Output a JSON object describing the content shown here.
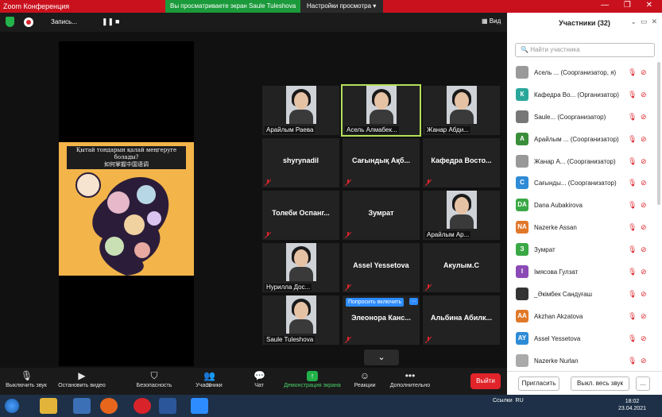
{
  "window": {
    "title": "Zoom Конференция",
    "share_banner": "Вы просматриваете экран Saule Tuleshova",
    "view_settings": "Настройки просмотра",
    "controls": "—  ❐  ✕"
  },
  "recording": {
    "label": "Запись...",
    "pause": "❚❚",
    "stop": "■"
  },
  "view": {
    "label": "Вид"
  },
  "poster": {
    "caption": "Қытай тондарын қалай меңгеруге болады?\n如何掌握中国语调"
  },
  "tiles": [
    {
      "name": "Арайлым Раева",
      "type": "video"
    },
    {
      "name": "Асель Алмабек...",
      "type": "video",
      "active": true
    },
    {
      "name": "Жанар Абди...",
      "type": "video"
    },
    {
      "name": "shyrynadil",
      "type": "name"
    },
    {
      "name": "Сағындық Ақб...",
      "type": "name"
    },
    {
      "name": "Кафедра Восто...",
      "type": "name"
    },
    {
      "name": "Толеби Оспанг...",
      "type": "name"
    },
    {
      "name": "Зумрат",
      "type": "name"
    },
    {
      "name": "Арайлым Ар...",
      "type": "video"
    },
    {
      "name": "Нурилла Дос...",
      "type": "video"
    },
    {
      "name": "Assel Yessetova",
      "type": "name"
    },
    {
      "name": "Акулым.С",
      "type": "name"
    },
    {
      "name": "Saule Tuleshova",
      "type": "video"
    },
    {
      "name": "Элеонора Канс...",
      "type": "name"
    },
    {
      "name": "Альбина Абилк...",
      "type": "name"
    }
  ],
  "ask_unmute": "Попросить включить",
  "toolbar": {
    "mute": "Выключить звук",
    "video": "Остановить видео",
    "security": "Безопасность",
    "participants": "Участники",
    "participants_count": "32",
    "chat": "Чат",
    "share": "Демонстрация экрана",
    "reactions": "Реакции",
    "more": "Дополнительно",
    "leave": "Выйти"
  },
  "panel": {
    "title": "Участники (32)",
    "search_placeholder": "Найти участника",
    "invite": "Пригласить",
    "mute_all": "Выкл. весь звук",
    "more": "...",
    "participants": [
      {
        "initials": "",
        "name": "Асель ... (Соорганизатор, я)",
        "color": "#9a9a9a"
      },
      {
        "initials": "К",
        "name": "Кафедра Во... (Организатор)",
        "color": "#2aa79b"
      },
      {
        "initials": "",
        "name": "Saule... (Соорганизатор)",
        "color": "#777"
      },
      {
        "initials": "А",
        "name": "Арайлым ... (Соорганизатор)",
        "color": "#3a8e3a"
      },
      {
        "initials": "",
        "name": "Жанар А... (Соорганизатор)",
        "color": "#999"
      },
      {
        "initials": "С",
        "name": "Сағынды... (Соорганизатор)",
        "color": "#2e8bd6"
      },
      {
        "initials": "DA",
        "name": "Dana Aubakirova",
        "color": "#3aa844"
      },
      {
        "initials": "NA",
        "name": "Nazerke Assan",
        "color": "#e0782a"
      },
      {
        "initials": "З",
        "name": "Зумрат",
        "color": "#3aa844"
      },
      {
        "initials": "I",
        "name": "Імясова Гулзат",
        "color": "#8b4ab5"
      },
      {
        "initials": "",
        "name": "_Әкімбек Сандуғаш",
        "color": "#333"
      },
      {
        "initials": "AA",
        "name": "Akzhan Akzatova",
        "color": "#e0782a"
      },
      {
        "initials": "AY",
        "name": "Assel Yessetova",
        "color": "#2e8bd6"
      },
      {
        "initials": "",
        "name": "Nazerke Nurlan",
        "color": "#aaa"
      }
    ]
  },
  "taskbar": {
    "tray": "Ссылки",
    "lang": "RU",
    "time": "18:02",
    "date": "23.04.2021"
  }
}
